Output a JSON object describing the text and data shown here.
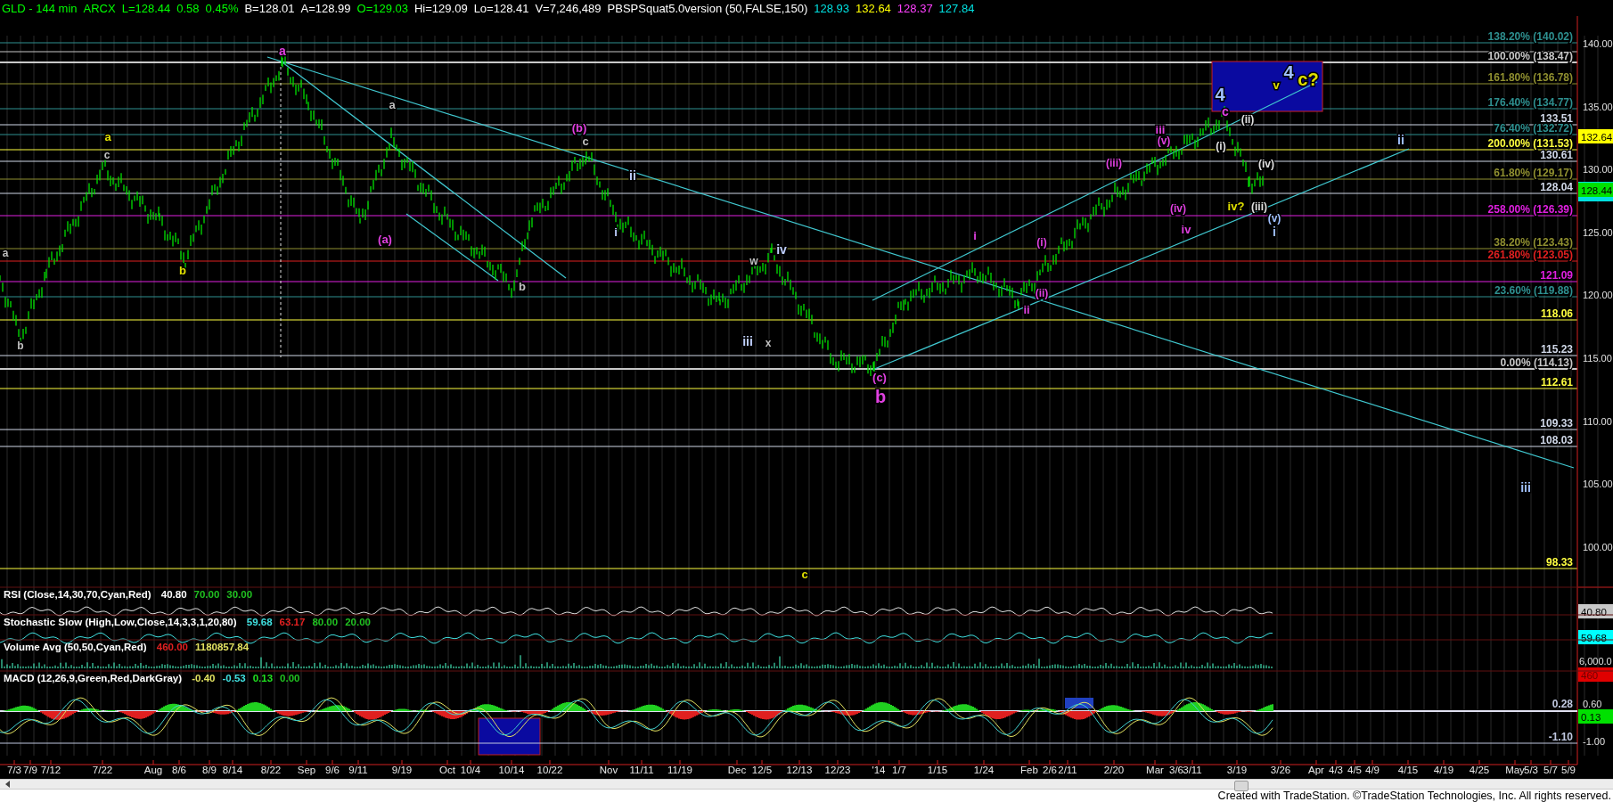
{
  "header": {
    "fields": [
      {
        "text": "GLD - 144 min",
        "color": "#00ff00"
      },
      {
        "text": "ARCX",
        "color": "#00ff00"
      },
      {
        "text": "L=128.44",
        "color": "#00ff00"
      },
      {
        "text": "0.58",
        "color": "#00ff00"
      },
      {
        "text": "0.45%",
        "color": "#00ff00"
      },
      {
        "text": "B=128.01",
        "color": "#ffffff"
      },
      {
        "text": "A=128.99",
        "color": "#ffffff"
      },
      {
        "text": "O=129.03",
        "color": "#00ff00"
      },
      {
        "text": "Hi=129.09",
        "color": "#ffffff"
      },
      {
        "text": "Lo=128.41",
        "color": "#ffffff"
      },
      {
        "text": "V=7,246,489",
        "color": "#ffffff"
      },
      {
        "text": "PBSPSquat5.0version (50,FALSE,150)",
        "color": "#ffffff"
      },
      {
        "text": "128.93",
        "color": "#00e0e0"
      },
      {
        "text": "132.64",
        "color": "#ffff00"
      },
      {
        "text": "128.37",
        "color": "#ff40ff"
      },
      {
        "text": "127.84",
        "color": "#00e0e0"
      }
    ]
  },
  "price_axis": {
    "ticks": [
      "140.00",
      "135.00",
      "130.00",
      "125.00",
      "120.00",
      "115.00",
      "110.00",
      "105.00",
      "100.00"
    ],
    "badges": [
      {
        "text": "132.64",
        "color": "#ffff00"
      },
      {
        "text": "128.44",
        "color": "#00e000"
      }
    ]
  },
  "levels": [
    {
      "label": "138.20% (140.02)",
      "color": "#2e9090"
    },
    {
      "label": "100.00% (138.47)",
      "color": "#c8c8c8"
    },
    {
      "label": "161.80% (136.78)",
      "color": "#909030"
    },
    {
      "label": "176.40% (134.77)",
      "color": "#2e9090"
    },
    {
      "label": "133.51",
      "color": "#d0d8e8"
    },
    {
      "label": "76.40% (132.72)",
      "color": "#2e9090"
    },
    {
      "label": "200.00% (131.53)",
      "color": "#ffff40"
    },
    {
      "label": "130.61",
      "color": "#d0d8e8"
    },
    {
      "label": "61.80% (129.17)",
      "color": "#909030"
    },
    {
      "label": "128.04",
      "color": "#d0d8e8"
    },
    {
      "label": "258.00% (126.39)",
      "color": "#e020e0"
    },
    {
      "label": "38.20% (123.43)",
      "color": "#909030"
    },
    {
      "label": "261.80% (123.05)",
      "color": "#e02020"
    },
    {
      "label": "121.09",
      "color": "#e020e0"
    },
    {
      "label": "23.60% (119.88)",
      "color": "#2e9090"
    },
    {
      "label": "118.06",
      "color": "#ffff40"
    },
    {
      "label": "115.23",
      "color": "#d0d8e8"
    },
    {
      "label": "0.00% (114.13)",
      "color": "#c8c8c8"
    },
    {
      "label": "112.61",
      "color": "#ffff40"
    },
    {
      "label": "109.33",
      "color": "#d0d8e8"
    },
    {
      "label": "108.03",
      "color": "#d0d8e8"
    },
    {
      "label": "98.33",
      "color": "#ffff40"
    }
  ],
  "wave_labels": [
    {
      "text": "a",
      "color": "#e040e0",
      "kind": "medium"
    },
    {
      "text": "a",
      "color": "#e0e000",
      "kind": "normal"
    },
    {
      "text": "c",
      "color": "#c0c0c0",
      "kind": "small"
    },
    {
      "text": "b",
      "color": "#e0e000",
      "kind": "normal"
    },
    {
      "text": "a",
      "color": "#c0c0c0",
      "kind": "small"
    },
    {
      "text": "b",
      "color": "#c0c0c0",
      "kind": "small"
    },
    {
      "text": "a",
      "color": "#c0c0c0",
      "kind": "normal"
    },
    {
      "text": "(a)",
      "color": "#e040e0",
      "kind": "normal"
    },
    {
      "text": "b",
      "color": "#c0c0c0",
      "kind": "normal"
    },
    {
      "text": "(b)",
      "color": "#e040e0",
      "kind": "normal"
    },
    {
      "text": "c",
      "color": "#c0c0c0",
      "kind": "normal"
    },
    {
      "text": "ii",
      "color": "#c0d0ff",
      "kind": "medium"
    },
    {
      "text": "i",
      "color": "#c0d0ff",
      "kind": "normal"
    },
    {
      "text": "iv",
      "color": "#c0d0ff",
      "kind": "medium"
    },
    {
      "text": "w",
      "color": "#c0c0c0",
      "kind": "small"
    },
    {
      "text": "iii",
      "color": "#c0d0ff",
      "kind": "medium"
    },
    {
      "text": "x",
      "color": "#c0c0c0",
      "kind": "small"
    },
    {
      "text": "(c)",
      "color": "#e040e0",
      "kind": "normal"
    },
    {
      "text": "b",
      "color": "#e040e0",
      "kind": "large"
    },
    {
      "text": "i",
      "color": "#e040e0",
      "kind": "normal"
    },
    {
      "text": "(i)",
      "color": "#e040e0",
      "kind": "small"
    },
    {
      "text": "(ii)",
      "color": "#e040e0",
      "kind": "small"
    },
    {
      "text": "ii",
      "color": "#e040e0",
      "kind": "normal"
    },
    {
      "text": "(iii)",
      "color": "#e040e0",
      "kind": "small"
    },
    {
      "text": "(iv)",
      "color": "#e040e0",
      "kind": "small"
    },
    {
      "text": "iii",
      "color": "#e040e0",
      "kind": "normal"
    },
    {
      "text": "(v)",
      "color": "#e040e0",
      "kind": "small"
    },
    {
      "text": "iv",
      "color": "#e040e0",
      "kind": "normal"
    },
    {
      "text": "4",
      "color": "#a0c0ff",
      "kind": "large"
    },
    {
      "text": "c",
      "color": "#e040e0",
      "kind": "medium"
    },
    {
      "text": "(ii)",
      "color": "#e0e0e0",
      "kind": "small"
    },
    {
      "text": "(i)",
      "color": "#e0e0e0",
      "kind": "small"
    },
    {
      "text": "(iv)",
      "color": "#e0e0e0",
      "kind": "small"
    },
    {
      "text": "iv?",
      "color": "#e0e000",
      "kind": "normal"
    },
    {
      "text": "(iii)",
      "color": "#e0e0e0",
      "kind": "small"
    },
    {
      "text": "(v)",
      "color": "#a0c0ff",
      "kind": "small"
    },
    {
      "text": "i",
      "color": "#a0c0ff",
      "kind": "medium"
    },
    {
      "text": "ii",
      "color": "#a0c0ff",
      "kind": "medium"
    },
    {
      "text": "iii",
      "color": "#a0c0ff",
      "kind": "medium"
    },
    {
      "text": "4",
      "color": "#a0c0ff",
      "kind": "large"
    },
    {
      "text": "c?",
      "color": "#e0e000",
      "kind": "large"
    },
    {
      "text": "v",
      "color": "#e0e000",
      "kind": "normal"
    },
    {
      "text": "c",
      "color": "#e0e000",
      "kind": "normal"
    }
  ],
  "indicators": [
    {
      "kind": "rsi",
      "title": "RSI (Close,14,30,70,Cyan,Red)",
      "values": [
        {
          "text": "40.80",
          "color": "#ffffff"
        },
        {
          "text": "70.00",
          "color": "#20c020"
        },
        {
          "text": "30.00",
          "color": "#20c020"
        }
      ],
      "badge": {
        "text": "40.80",
        "color": "#c8c8c8"
      }
    },
    {
      "kind": "stochastic",
      "title": "Stochastic Slow (High,Low,Close,14,3,3,1,20,80)",
      "values": [
        {
          "text": "59.68",
          "color": "#40e0e0"
        },
        {
          "text": "63.17",
          "color": "#e02020"
        },
        {
          "text": "80.00",
          "color": "#20c020"
        },
        {
          "text": "20.00",
          "color": "#20c020"
        }
      ],
      "badge": {
        "text": "59.68",
        "color": "#00ffff"
      }
    },
    {
      "kind": "volume",
      "title": "Volume Avg (50,50,Cyan,Red)",
      "values": [
        {
          "text": "460.00",
          "color": "#e02020"
        },
        {
          "text": "1180857.84",
          "color": "#e0e060"
        }
      ],
      "badge": {
        "text": "460",
        "color": "#e00000"
      },
      "axis_labels": [
        "6,000.0"
      ]
    },
    {
      "kind": "macd",
      "title": "MACD (12,26,9,Green,Red,DarkGray)",
      "values": [
        {
          "text": "-0.40",
          "color": "#e0e060"
        },
        {
          "text": "-0.53",
          "color": "#40e0e0"
        },
        {
          "text": "0.13",
          "color": "#20e020"
        },
        {
          "text": "0.00",
          "color": "#20c020"
        }
      ],
      "badge": {
        "text": "0.13",
        "color": "#00e000"
      },
      "axis_labels": [
        "0.60",
        "-1.00"
      ],
      "right_labels": [
        "0.28",
        "-1.10"
      ]
    }
  ],
  "date_axis": [
    "7/3",
    "7/9",
    "7/12",
    "7/22",
    "Aug",
    "8/6",
    "8/9",
    "8/14",
    "8/22",
    "Sep",
    "9/6",
    "9/11",
    "9/19",
    "Oct",
    "10/4",
    "10/14",
    "10/22",
    "Nov",
    "11/11",
    "11/19",
    "Dec",
    "12/5",
    "12/13",
    "12/23",
    "'14",
    "1/7",
    "1/15",
    "1/24",
    "Feb",
    "2/6",
    "2/11",
    "2/20",
    "Mar",
    "3/6",
    "3/11",
    "3/19",
    "3/26",
    "Apr",
    "4/3",
    "4/5",
    "4/9",
    "4/15",
    "4/19",
    "4/25",
    "May",
    "5/3",
    "5/7",
    "5/9"
  ],
  "footer": "Created with TradeStation. ©TradeStation Technologies, Inc. All rights reserved."
}
